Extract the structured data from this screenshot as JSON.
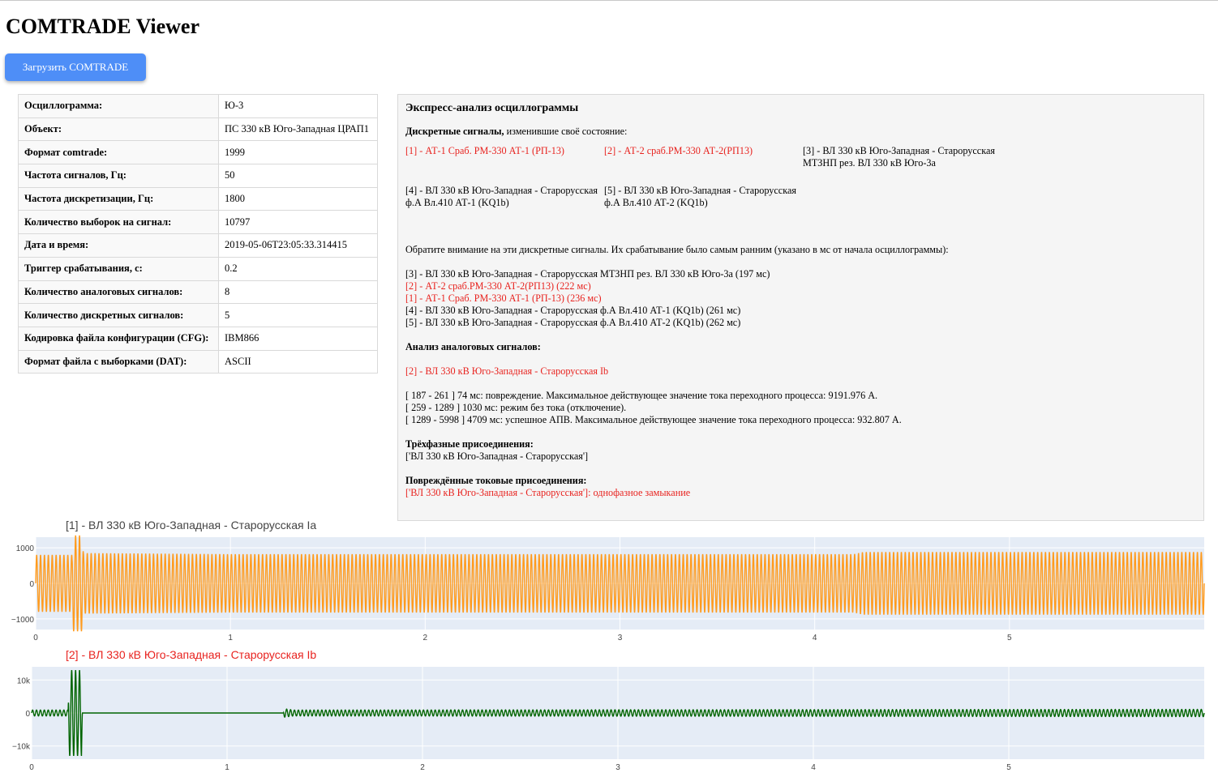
{
  "app": {
    "title": "COMTRADE Viewer"
  },
  "toolbar": {
    "upload_label": "Загрузить COMTRADE"
  },
  "info": [
    {
      "key": "Осциллограмма:",
      "value": "Ю-3"
    },
    {
      "key": "Объект:",
      "value": "ПС 330 кВ Юго-Западная ЦРАП1"
    },
    {
      "key": "Формат comtrade:",
      "value": "1999"
    },
    {
      "key": "Частота сигналов, Гц:",
      "value": "50"
    },
    {
      "key": "Частота дискретизации, Гц:",
      "value": "1800"
    },
    {
      "key": "Количество выборок на сигнал:",
      "value": "10797"
    },
    {
      "key": "Дата и время:",
      "value": "2019-05-06T23:05:33.314415"
    },
    {
      "key": "Триггер срабатывания, с:",
      "value": "0.2"
    },
    {
      "key": "Количество аналоговых сигналов:",
      "value": "8"
    },
    {
      "key": "Количество дискретных сигналов:",
      "value": "5"
    },
    {
      "key": "Кодировка файла конфигурации (CFG):",
      "value": "IBM866"
    },
    {
      "key": "Формат файла с выборками (DAT):",
      "value": "ASCII"
    }
  ],
  "analysis": {
    "title": "Экспресс-анализ осциллограммы",
    "discrete_heading_bold": "Дискретные сигналы,",
    "discrete_heading_rest": " изменившие своё состояние:",
    "discrete_signals": [
      {
        "text": "[1] - АТ-1 Сраб. РМ-330 АТ-1 (РП-13)",
        "highlight": true
      },
      {
        "text": "[2] - АТ-2 сраб.РМ-330 АТ-2(РП13)",
        "highlight": true
      },
      {
        "text": "[3] - ВЛ 330 кВ Юго-Западная - Старорусская МТЗНП рез. ВЛ 330 кВ Юго-3а",
        "highlight": false
      },
      {
        "text": "[4] - ВЛ 330 кВ Юго-Западная - Старорусская ф.А Вл.410 АТ-1 (KQ1b)",
        "highlight": false
      },
      {
        "text": "[5] - ВЛ 330 кВ Юго-Западная - Старорусская ф.А Вл.410 АТ-2 (KQ1b)",
        "highlight": false
      }
    ],
    "earliest_note": "Обратите внимание на эти дискретные сигналы. Их срабатывание было самым ранним (указано в мс от начала осциллограммы):",
    "earliest": [
      {
        "text": "[3] - ВЛ 330 кВ Юго-Западная - Старорусская МТЗНП рез. ВЛ 330 кВ Юго-3а (197 мс)",
        "highlight": false
      },
      {
        "text": "[2] - АТ-2 сраб.РМ-330 АТ-2(РП13) (222 мс)",
        "highlight": true
      },
      {
        "text": "[1] - АТ-1 Сраб. РМ-330 АТ-1 (РП-13) (236 мс)",
        "highlight": true
      },
      {
        "text": "[4] - ВЛ 330 кВ Юго-Западная - Старорусская ф.А Вл.410 АТ-1 (KQ1b) (261 мс)",
        "highlight": false
      },
      {
        "text": "[5] - ВЛ 330 кВ Юго-Западная - Старорусская ф.А Вл.410 АТ-2 (KQ1b) (262 мс)",
        "highlight": false
      }
    ],
    "analog_heading": "Анализ аналоговых сигналов:",
    "analog_signal": "[2] - ВЛ 330 кВ Юго-Западная - Старорусская Ib",
    "intervals": [
      "[ 187 - 261 ] 74 мс: повреждение. Максимальное действующее значение тока переходного процесса: 9191.976 А.",
      "[ 259 - 1289 ] 1030 мс: режим без тока (отключение).",
      "[ 1289 - 5998 ] 4709 мс: успешное АПВ. Максимальное действующее значение тока переходного процесса: 932.807 А."
    ],
    "three_phase_heading": "Трёхфазные присоединения:",
    "three_phase_value": "['ВЛ 330 кВ Юго-Западная - Старорусская']",
    "damaged_heading": "Повреждённые токовые присоединения:",
    "damaged_value": "['ВЛ 330 кВ Юго-Западная - Старорусская']: однофазное замыкание"
  },
  "colors": {
    "accent": "#4e8ef7",
    "highlight": "#e8231f",
    "series1": "#ff9b1e",
    "series2": "#006400",
    "plot_bg": "#e5ecf6"
  },
  "chart_data": [
    {
      "type": "line",
      "title": "[1] - ВЛ 330 кВ Юго-Западная - Старорусская Ia",
      "title_highlight": false,
      "xlim": [
        0,
        6.0
      ],
      "ylim": [
        -1300,
        1300
      ],
      "xticks": [
        0,
        1,
        2,
        3,
        4,
        5
      ],
      "yticks": [
        {
          "v": 1000,
          "label": "1000"
        },
        {
          "v": 0,
          "label": "0"
        },
        {
          "v": -1000,
          "label": "−1000"
        }
      ],
      "frequency_hz": 50,
      "color": "#ff9b1e",
      "amplitude": [
        {
          "t": 0,
          "a": 800
        },
        {
          "t": 0.187,
          "a": 800
        },
        {
          "t": 0.19,
          "a": 1350
        },
        {
          "t": 0.24,
          "a": 1350
        },
        {
          "t": 0.245,
          "a": 850
        },
        {
          "t": 1.0,
          "a": 820
        },
        {
          "t": 4.2,
          "a": 820
        },
        {
          "t": 4.25,
          "a": 880
        },
        {
          "t": 6.0,
          "a": 880
        }
      ]
    },
    {
      "type": "line",
      "title": "[2] - ВЛ 330 кВ Юго-Западная - Старорусская Ib",
      "title_highlight": true,
      "xlim": [
        0,
        6.0
      ],
      "ylim": [
        -14000,
        14000
      ],
      "xticks": [
        0,
        1,
        2,
        3,
        4,
        5
      ],
      "yticks": [
        {
          "v": 10000,
          "label": "10k"
        },
        {
          "v": 0,
          "label": "0"
        },
        {
          "v": -10000,
          "label": "−10k"
        }
      ],
      "frequency_hz": 50,
      "color": "#006400",
      "amplitude": [
        {
          "t": 0,
          "a": 900
        },
        {
          "t": 0.187,
          "a": 900
        },
        {
          "t": 0.19,
          "a": 13000
        },
        {
          "t": 0.255,
          "a": 13000
        },
        {
          "t": 0.26,
          "a": 0
        },
        {
          "t": 1.289,
          "a": 0
        },
        {
          "t": 1.29,
          "a": 1300
        },
        {
          "t": 1.34,
          "a": 900
        },
        {
          "t": 6.0,
          "a": 1100
        }
      ]
    }
  ]
}
